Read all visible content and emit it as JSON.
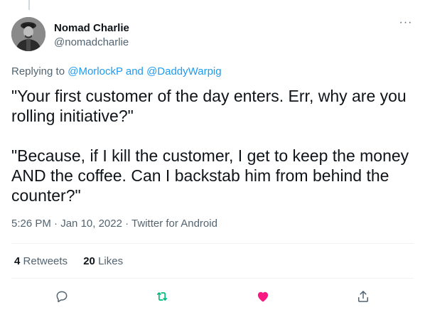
{
  "tweet": {
    "display_name": "Nomad Charlie",
    "handle": "@nomadcharlie",
    "replying_prefix": "Replying to",
    "replying_user_1": "@MorlockP",
    "replying_and": "and",
    "replying_user_2": "@DaddyWarpig",
    "paragraph_1": "\"Your first customer of the day enters. Err, why are you rolling initiative?\"",
    "paragraph_2": "\"Because, if I kill the customer, I get to keep the money AND the coffee. Can I backstab him from behind the counter?\"",
    "time": "5:26 PM",
    "date": "Jan 10, 2022",
    "source": "Twitter for Android",
    "separator": "·",
    "more_label": "···"
  },
  "stats": {
    "retweets_count": "4",
    "retweets_label": "Retweets",
    "likes_count": "20",
    "likes_label": "Likes"
  },
  "icons": {
    "reply": "reply-icon",
    "retweet": "retweet-icon",
    "like": "heart-icon",
    "share": "share-icon"
  },
  "colors": {
    "link": "#1d9bf0",
    "retweet_active": "#00ba7c",
    "like_active": "#f91880",
    "muted": "#536471"
  }
}
